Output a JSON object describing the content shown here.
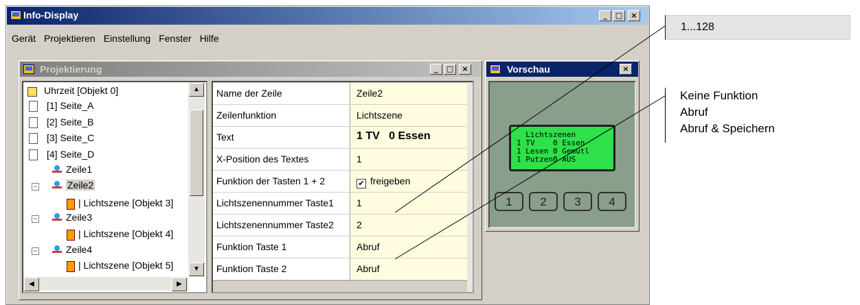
{
  "window": {
    "title": "Info-Display",
    "min": "_",
    "max": "□",
    "close": "×"
  },
  "menu": [
    "Gerät",
    "Projektieren",
    "Einstellung",
    "Fenster",
    "Hilfe"
  ],
  "projektierung": {
    "title": "Projektierung"
  },
  "tree": [
    {
      "label": "Uhrzeit [Objekt 0]"
    },
    {
      "label": "[1] Seite_A"
    },
    {
      "label": "[2] Seite_B"
    },
    {
      "label": "[3] Seite_C"
    },
    {
      "label": "[4] Seite_D"
    },
    {
      "label": "Zeile1"
    },
    {
      "label": "Zeile2"
    },
    {
      "label": "| Lichtszene [Objekt 3]"
    },
    {
      "label": "Zeile3"
    },
    {
      "label": "| Lichtszene [Objekt 4]"
    },
    {
      "label": "Zeile4"
    },
    {
      "label": "| Lichtszene [Objekt 5]"
    }
  ],
  "properties": [
    {
      "name": "Name der Zeile",
      "value": "Zeile2"
    },
    {
      "name": "Zeilenfunktion",
      "value": "Lichtszene"
    },
    {
      "name": "Text",
      "value": "1 TV   0 Essen"
    },
    {
      "name": "X-Position des Textes",
      "value": "1"
    },
    {
      "name": "Funktion der Tasten 1 + 2",
      "value": "freigeben",
      "checked": true
    },
    {
      "name": "Lichtszenennummer Taste1",
      "value": "1"
    },
    {
      "name": "Lichtszenennummer Taste2",
      "value": "2"
    },
    {
      "name": "Funktion Taste 1",
      "value": "Abruf"
    },
    {
      "name": "Funktion Taste 2",
      "value": "Abruf"
    }
  ],
  "vorschau": {
    "title": "Vorschau",
    "lcd_lines": [
      "  Lichtszenen",
      "1 TV    0 Essen",
      "1 Lesen 0 Gemütl",
      "1 Putzen0 AUS"
    ],
    "buttons": [
      "1",
      "2",
      "3",
      "4"
    ]
  },
  "callouts": {
    "range": "1...128",
    "functions": [
      "Keine Funktion",
      "Abruf",
      "Abruf & Speichern"
    ]
  },
  "colors": {
    "titlebar": "#0a246a",
    "lcd": "#2ee04a",
    "property_value_bg": "#fffce0"
  }
}
